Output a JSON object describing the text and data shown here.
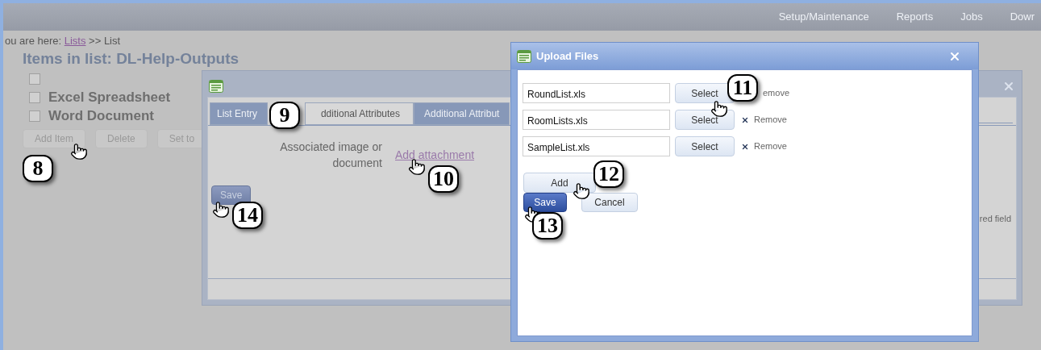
{
  "nav": [
    "Setup/Maintenance",
    "Reports",
    "Jobs",
    "Dowr"
  ],
  "breadcrumb": {
    "prefix": "ou are here:",
    "link": "Lists",
    "rest": ">> List"
  },
  "title": "Items in list: DL-Help-Outputs",
  "items": [
    {
      "checked": false
    },
    {
      "label": "Excel Spreadsheet",
      "checked": false
    },
    {
      "label": "Word Document",
      "checked": false
    }
  ],
  "buttons": [
    "Add Item",
    "Delete",
    "Set to"
  ],
  "list_dialog": {
    "tabs": [
      {
        "label": "List Entry",
        "selected": false
      },
      {
        "label": "dditional Attributes",
        "selected": true
      },
      {
        "label": "Additional Attribut",
        "selected": false
      }
    ],
    "field_label": "Associated image or document",
    "link": "Add attachment",
    "save": "Save",
    "side_note": "red field"
  },
  "upload_dialog": {
    "title": "Upload Files",
    "files": [
      {
        "name": "RoundList.xls",
        "select": "Select",
        "remove": "emove"
      },
      {
        "name": "RoomLists.xls",
        "select": "Select",
        "remove": "Remove"
      },
      {
        "name": "SampleList.xls",
        "select": "Select",
        "remove": "Remove"
      }
    ],
    "add": "Add",
    "save": "Save",
    "cancel": "Cancel"
  },
  "callouts": [
    "8",
    "9",
    "10",
    "11",
    "12",
    "13",
    "14"
  ]
}
